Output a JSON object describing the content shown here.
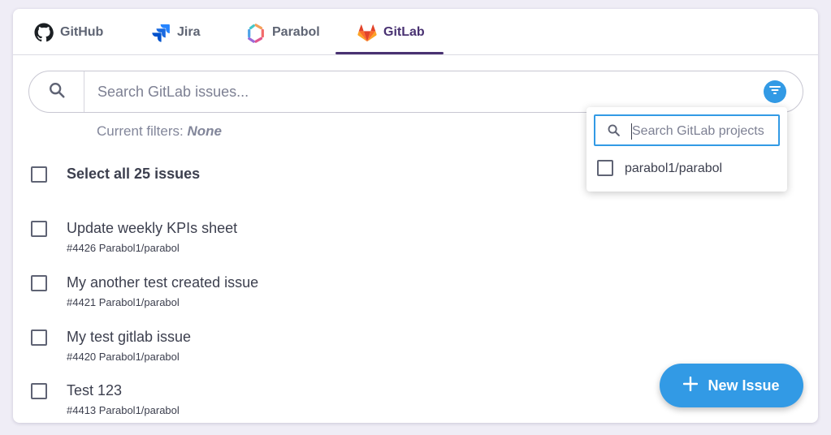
{
  "tabs": [
    {
      "label": "GitHub",
      "icon": "github-icon"
    },
    {
      "label": "Jira",
      "icon": "jira-icon"
    },
    {
      "label": "Parabol",
      "icon": "parabol-icon"
    },
    {
      "label": "GitLab",
      "icon": "gitlab-icon",
      "active": true
    }
  ],
  "search": {
    "placeholder": "Search GitLab issues...",
    "value": ""
  },
  "filters": {
    "label": "Current filters:",
    "value": "None"
  },
  "select_all_label": "Select all 25 issues",
  "issues": [
    {
      "title": "Update weekly KPIs sheet",
      "meta": "#4426 Parabol1/parabol"
    },
    {
      "title": "My another test created issue",
      "meta": "#4421 Parabol1/parabol"
    },
    {
      "title": "My test gitlab issue",
      "meta": "#4420 Parabol1/parabol"
    },
    {
      "title": "Test 123",
      "meta": "#4413 Parabol1/parabol"
    }
  ],
  "new_issue_label": "New Issue",
  "project_dropdown": {
    "placeholder": "Search GitLab projects",
    "items": [
      {
        "label": "parabol1/parabol",
        "checked": false
      }
    ]
  },
  "colors": {
    "accent": "#329ae5",
    "active_tab": "#493272",
    "background": "#efedf6"
  }
}
